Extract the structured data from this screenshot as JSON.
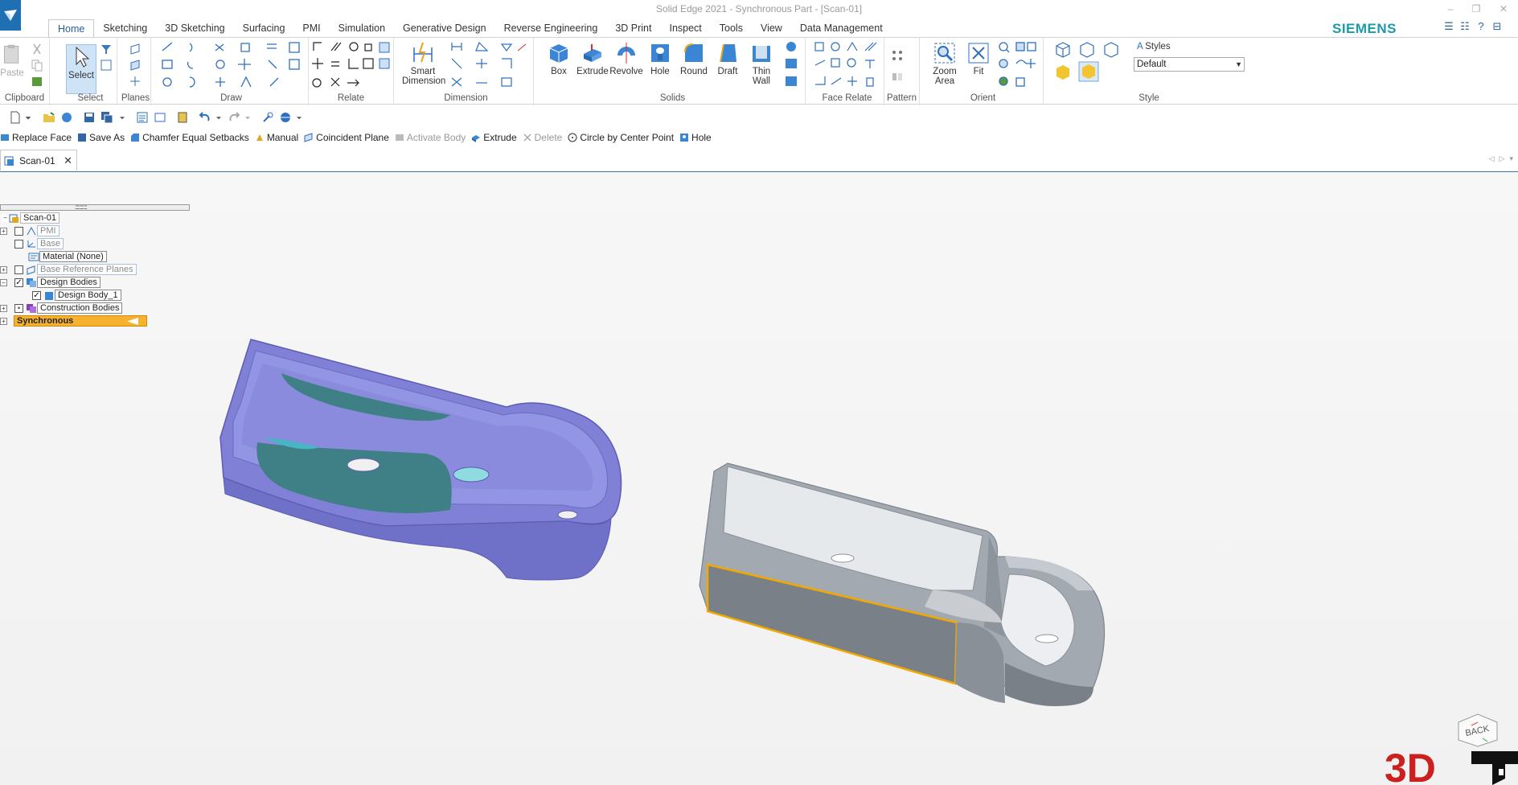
{
  "window": {
    "title": "Solid Edge 2021 - Synchronous Part - [Scan-01]"
  },
  "branding": {
    "vendor": "SIEMENS",
    "watermark": "3D"
  },
  "ribbon": {
    "tabs": [
      {
        "label": "Home",
        "active": true
      },
      {
        "label": "Sketching"
      },
      {
        "label": "3D Sketching"
      },
      {
        "label": "Surfacing"
      },
      {
        "label": "PMI"
      },
      {
        "label": "Simulation"
      },
      {
        "label": "Generative Design"
      },
      {
        "label": "Reverse Engineering"
      },
      {
        "label": "3D Print"
      },
      {
        "label": "Inspect"
      },
      {
        "label": "Tools"
      },
      {
        "label": "View"
      },
      {
        "label": "Data Management"
      }
    ],
    "groups": {
      "clipboard": {
        "label": "Clipboard",
        "paste": "Paste"
      },
      "select": {
        "label": "Select",
        "select": "Select"
      },
      "planes": {
        "label": "Planes"
      },
      "draw": {
        "label": "Draw"
      },
      "relate": {
        "label": "Relate"
      },
      "dimension": {
        "label": "Dimension",
        "smart_dimension": "Smart Dimension"
      },
      "solids": {
        "label": "Solids",
        "box": "Box",
        "extrude": "Extrude",
        "revolve": "Revolve",
        "hole": "Hole",
        "round": "Round",
        "draft": "Draft",
        "thin_wall": "Thin Wall"
      },
      "face_relate": {
        "label": "Face Relate"
      },
      "pattern": {
        "label": "Pattern"
      },
      "orient": {
        "label": "Orient",
        "zoom_area": "Zoom Area",
        "fit": "Fit"
      },
      "style": {
        "label": "Style",
        "styles_label": "Styles",
        "styles_value": "Default"
      }
    }
  },
  "command_bar": [
    {
      "label": "Replace Face",
      "enabled": true
    },
    {
      "label": "Save As",
      "enabled": true
    },
    {
      "label": "Chamfer Equal Setbacks",
      "enabled": true
    },
    {
      "label": "Manual",
      "enabled": true
    },
    {
      "label": "Coincident Plane",
      "enabled": true
    },
    {
      "label": "Activate Body",
      "enabled": false
    },
    {
      "label": "Extrude",
      "enabled": true
    },
    {
      "label": "Delete",
      "enabled": false
    },
    {
      "label": "Circle by Center Point",
      "enabled": true
    },
    {
      "label": "Hole",
      "enabled": true
    }
  ],
  "document_tab": {
    "label": "Scan-01"
  },
  "pathfinder": {
    "items": [
      {
        "label": "Scan-01"
      },
      {
        "label": "PMI"
      },
      {
        "label": "Base"
      },
      {
        "label": "Material (None)"
      },
      {
        "label": "Base Reference Planes"
      },
      {
        "label": "Design Bodies"
      },
      {
        "label": "Design Body_1"
      },
      {
        "label": "Construction Bodies"
      },
      {
        "label": "Synchronous"
      }
    ]
  },
  "view_cube": {
    "label": "BACK"
  },
  "colors": {
    "scan_body": "#7f80d6",
    "scan_patch": "#3f7f86",
    "design_body": "#9aa1aa",
    "selection_edge": "#f2a800",
    "accent": "#1f6fb3"
  }
}
